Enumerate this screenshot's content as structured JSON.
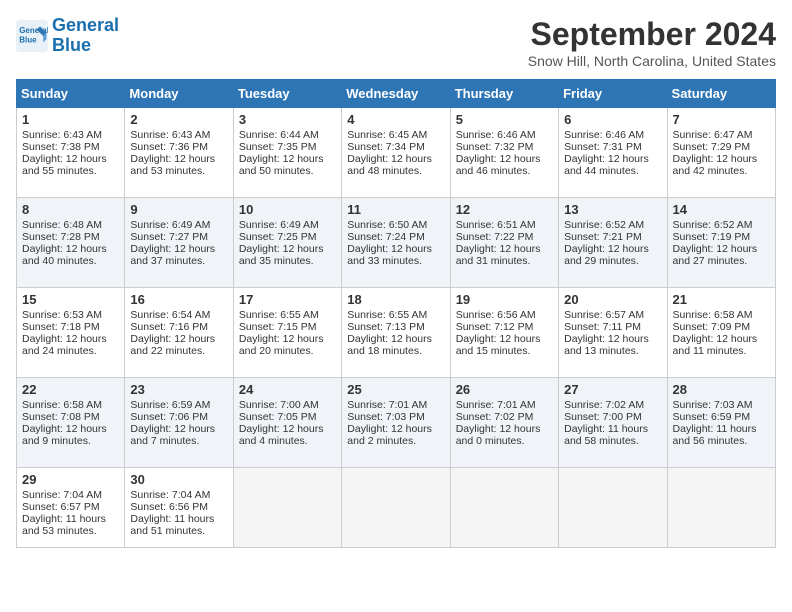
{
  "logo": {
    "line1": "General",
    "line2": "Blue"
  },
  "title": "September 2024",
  "location": "Snow Hill, North Carolina, United States",
  "days_of_week": [
    "Sunday",
    "Monday",
    "Tuesday",
    "Wednesday",
    "Thursday",
    "Friday",
    "Saturday"
  ],
  "weeks": [
    [
      {
        "day": "1",
        "sunrise": "Sunrise: 6:43 AM",
        "sunset": "Sunset: 7:38 PM",
        "daylight": "Daylight: 12 hours and 55 minutes."
      },
      {
        "day": "2",
        "sunrise": "Sunrise: 6:43 AM",
        "sunset": "Sunset: 7:36 PM",
        "daylight": "Daylight: 12 hours and 53 minutes."
      },
      {
        "day": "3",
        "sunrise": "Sunrise: 6:44 AM",
        "sunset": "Sunset: 7:35 PM",
        "daylight": "Daylight: 12 hours and 50 minutes."
      },
      {
        "day": "4",
        "sunrise": "Sunrise: 6:45 AM",
        "sunset": "Sunset: 7:34 PM",
        "daylight": "Daylight: 12 hours and 48 minutes."
      },
      {
        "day": "5",
        "sunrise": "Sunrise: 6:46 AM",
        "sunset": "Sunset: 7:32 PM",
        "daylight": "Daylight: 12 hours and 46 minutes."
      },
      {
        "day": "6",
        "sunrise": "Sunrise: 6:46 AM",
        "sunset": "Sunset: 7:31 PM",
        "daylight": "Daylight: 12 hours and 44 minutes."
      },
      {
        "day": "7",
        "sunrise": "Sunrise: 6:47 AM",
        "sunset": "Sunset: 7:29 PM",
        "daylight": "Daylight: 12 hours and 42 minutes."
      }
    ],
    [
      {
        "day": "8",
        "sunrise": "Sunrise: 6:48 AM",
        "sunset": "Sunset: 7:28 PM",
        "daylight": "Daylight: 12 hours and 40 minutes."
      },
      {
        "day": "9",
        "sunrise": "Sunrise: 6:49 AM",
        "sunset": "Sunset: 7:27 PM",
        "daylight": "Daylight: 12 hours and 37 minutes."
      },
      {
        "day": "10",
        "sunrise": "Sunrise: 6:49 AM",
        "sunset": "Sunset: 7:25 PM",
        "daylight": "Daylight: 12 hours and 35 minutes."
      },
      {
        "day": "11",
        "sunrise": "Sunrise: 6:50 AM",
        "sunset": "Sunset: 7:24 PM",
        "daylight": "Daylight: 12 hours and 33 minutes."
      },
      {
        "day": "12",
        "sunrise": "Sunrise: 6:51 AM",
        "sunset": "Sunset: 7:22 PM",
        "daylight": "Daylight: 12 hours and 31 minutes."
      },
      {
        "day": "13",
        "sunrise": "Sunrise: 6:52 AM",
        "sunset": "Sunset: 7:21 PM",
        "daylight": "Daylight: 12 hours and 29 minutes."
      },
      {
        "day": "14",
        "sunrise": "Sunrise: 6:52 AM",
        "sunset": "Sunset: 7:19 PM",
        "daylight": "Daylight: 12 hours and 27 minutes."
      }
    ],
    [
      {
        "day": "15",
        "sunrise": "Sunrise: 6:53 AM",
        "sunset": "Sunset: 7:18 PM",
        "daylight": "Daylight: 12 hours and 24 minutes."
      },
      {
        "day": "16",
        "sunrise": "Sunrise: 6:54 AM",
        "sunset": "Sunset: 7:16 PM",
        "daylight": "Daylight: 12 hours and 22 minutes."
      },
      {
        "day": "17",
        "sunrise": "Sunrise: 6:55 AM",
        "sunset": "Sunset: 7:15 PM",
        "daylight": "Daylight: 12 hours and 20 minutes."
      },
      {
        "day": "18",
        "sunrise": "Sunrise: 6:55 AM",
        "sunset": "Sunset: 7:13 PM",
        "daylight": "Daylight: 12 hours and 18 minutes."
      },
      {
        "day": "19",
        "sunrise": "Sunrise: 6:56 AM",
        "sunset": "Sunset: 7:12 PM",
        "daylight": "Daylight: 12 hours and 15 minutes."
      },
      {
        "day": "20",
        "sunrise": "Sunrise: 6:57 AM",
        "sunset": "Sunset: 7:11 PM",
        "daylight": "Daylight: 12 hours and 13 minutes."
      },
      {
        "day": "21",
        "sunrise": "Sunrise: 6:58 AM",
        "sunset": "Sunset: 7:09 PM",
        "daylight": "Daylight: 12 hours and 11 minutes."
      }
    ],
    [
      {
        "day": "22",
        "sunrise": "Sunrise: 6:58 AM",
        "sunset": "Sunset: 7:08 PM",
        "daylight": "Daylight: 12 hours and 9 minutes."
      },
      {
        "day": "23",
        "sunrise": "Sunrise: 6:59 AM",
        "sunset": "Sunset: 7:06 PM",
        "daylight": "Daylight: 12 hours and 7 minutes."
      },
      {
        "day": "24",
        "sunrise": "Sunrise: 7:00 AM",
        "sunset": "Sunset: 7:05 PM",
        "daylight": "Daylight: 12 hours and 4 minutes."
      },
      {
        "day": "25",
        "sunrise": "Sunrise: 7:01 AM",
        "sunset": "Sunset: 7:03 PM",
        "daylight": "Daylight: 12 hours and 2 minutes."
      },
      {
        "day": "26",
        "sunrise": "Sunrise: 7:01 AM",
        "sunset": "Sunset: 7:02 PM",
        "daylight": "Daylight: 12 hours and 0 minutes."
      },
      {
        "day": "27",
        "sunrise": "Sunrise: 7:02 AM",
        "sunset": "Sunset: 7:00 PM",
        "daylight": "Daylight: 11 hours and 58 minutes."
      },
      {
        "day": "28",
        "sunrise": "Sunrise: 7:03 AM",
        "sunset": "Sunset: 6:59 PM",
        "daylight": "Daylight: 11 hours and 56 minutes."
      }
    ],
    [
      {
        "day": "29",
        "sunrise": "Sunrise: 7:04 AM",
        "sunset": "Sunset: 6:57 PM",
        "daylight": "Daylight: 11 hours and 53 minutes."
      },
      {
        "day": "30",
        "sunrise": "Sunrise: 7:04 AM",
        "sunset": "Sunset: 6:56 PM",
        "daylight": "Daylight: 11 hours and 51 minutes."
      },
      null,
      null,
      null,
      null,
      null
    ]
  ]
}
